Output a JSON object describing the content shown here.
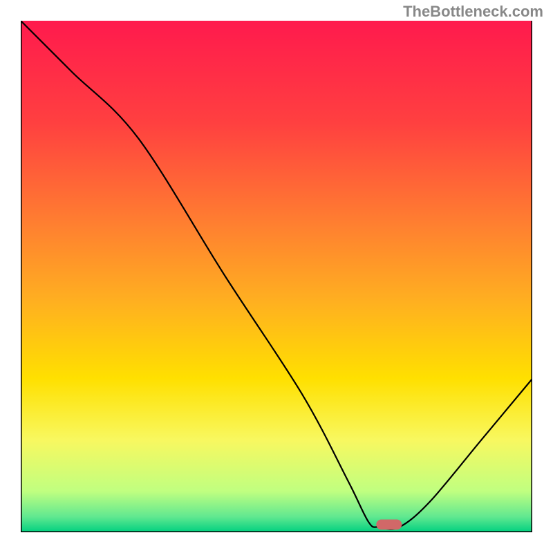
{
  "watermark": "TheBottleneck.com",
  "chart_data": {
    "type": "line",
    "title": "",
    "xlabel": "",
    "ylabel": "",
    "xlim": [
      0,
      100
    ],
    "ylim": [
      0,
      100
    ],
    "background_gradient": {
      "stops": [
        {
          "offset": 0.0,
          "color": "#ff1a4d"
        },
        {
          "offset": 0.2,
          "color": "#ff4040"
        },
        {
          "offset": 0.4,
          "color": "#ff8030"
        },
        {
          "offset": 0.55,
          "color": "#ffb020"
        },
        {
          "offset": 0.7,
          "color": "#ffe000"
        },
        {
          "offset": 0.82,
          "color": "#f8f860"
        },
        {
          "offset": 0.92,
          "color": "#c0ff80"
        },
        {
          "offset": 0.97,
          "color": "#60e890"
        },
        {
          "offset": 1.0,
          "color": "#00d080"
        }
      ]
    },
    "series": [
      {
        "name": "bottleneck-curve",
        "x": [
          0,
          10,
          23,
          40,
          55,
          64,
          68,
          70,
          74,
          80,
          90,
          100
        ],
        "y": [
          100,
          90,
          77,
          50,
          27,
          10,
          2,
          1,
          1,
          6,
          18,
          30
        ]
      }
    ],
    "marker": {
      "x": 72,
      "y": 1.5,
      "color": "#d16868",
      "width": 5,
      "height": 2
    },
    "frame_color": "#000000",
    "curve_color": "#000000",
    "curve_width": 2.2
  }
}
